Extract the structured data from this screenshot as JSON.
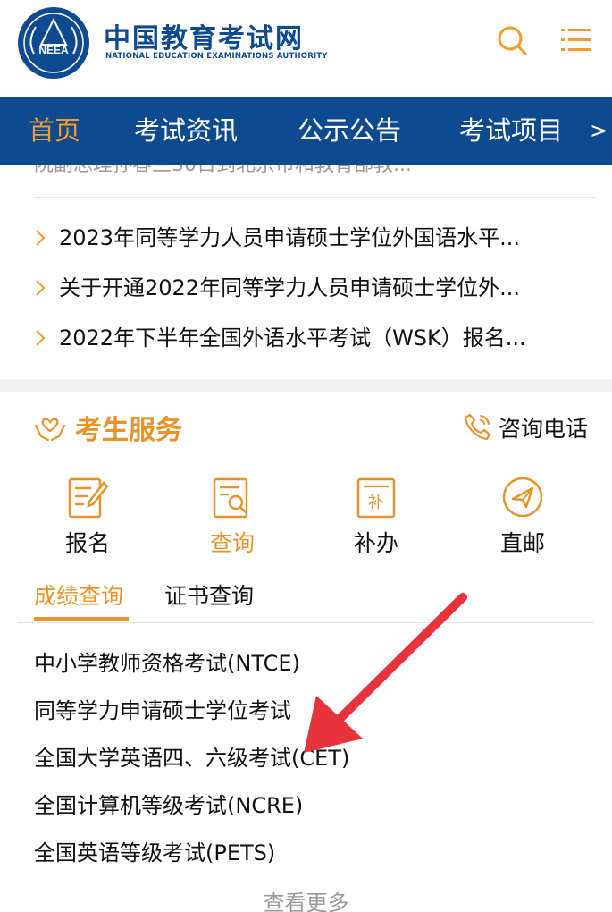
{
  "header": {
    "logo_text": "NEEA",
    "brand_cn": "中国教育考试网",
    "brand_en": "NATIONAL EDUCATION EXAMINATIONS AUTHORITY",
    "search_icon": "search-icon",
    "menu_icon": "menu-list-icon",
    "accent_color": "#f39b2b",
    "brand_color": "#0d4a8f"
  },
  "nav": {
    "items": [
      {
        "label": "首页",
        "active": true
      },
      {
        "label": "考试资讯",
        "active": false
      },
      {
        "label": "公示公告",
        "active": false
      },
      {
        "label": "考试项目",
        "active": false
      }
    ],
    "more": ">"
  },
  "news": {
    "partial_line": "院副总理孙春兰30日到北京市和教育部教...",
    "items": [
      "2023年同等学力人员申请硕士学位外国语水平...",
      "关于开通2022年同等学力人员申请硕士学位外...",
      "2022年下半年全国外语水平考试（WSK）报名..."
    ]
  },
  "services": {
    "title": "考生服务",
    "phone_label": "咨询电话",
    "items": [
      {
        "label": "报名",
        "icon": "register-form-icon"
      },
      {
        "label": "查询",
        "icon": "query-search-icon"
      },
      {
        "label": "补办",
        "icon": "reissue-icon"
      },
      {
        "label": "直邮",
        "icon": "direct-mail-plane-icon"
      }
    ]
  },
  "tabs": [
    {
      "label": "成绩查询",
      "active": true
    },
    {
      "label": "证书查询",
      "active": false
    }
  ],
  "exams": [
    "中小学教师资格考试(NTCE)",
    "同等学力申请硕士学位考试",
    "全国大学英语四、六级考试(CET)",
    "全国计算机等级考试(NCRE)",
    "全国英语等级考试(PETS)"
  ],
  "more_link": "查看更多",
  "annotation": {
    "type": "red-arrow",
    "color": "#e8323c",
    "points_to": "全国大学英语四、六级考试(CET)"
  }
}
